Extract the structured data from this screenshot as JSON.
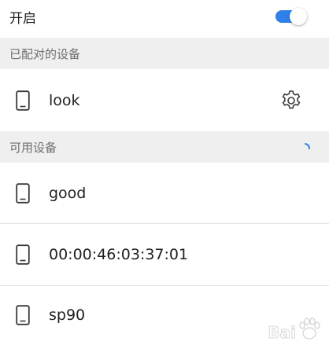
{
  "header": {
    "toggle_label": "开启",
    "toggle_on": true
  },
  "sections": {
    "paired_title": "已配对的设备",
    "available_title": "可用设备"
  },
  "paired_devices": [
    {
      "name": "look",
      "icon": "phone-icon",
      "action_icon": "gear-icon"
    }
  ],
  "available_devices": [
    {
      "name": "good",
      "icon": "phone-icon"
    },
    {
      "name": "00:00:46:03:37:01",
      "icon": "phone-icon"
    },
    {
      "name": "sp90",
      "icon": "phone-icon"
    }
  ],
  "watermark": {
    "text": "Bai"
  },
  "colors": {
    "accent": "#2f80e8",
    "section_bg": "#efefef",
    "section_text": "#6f6f6f",
    "divider": "#e2e2e2"
  }
}
